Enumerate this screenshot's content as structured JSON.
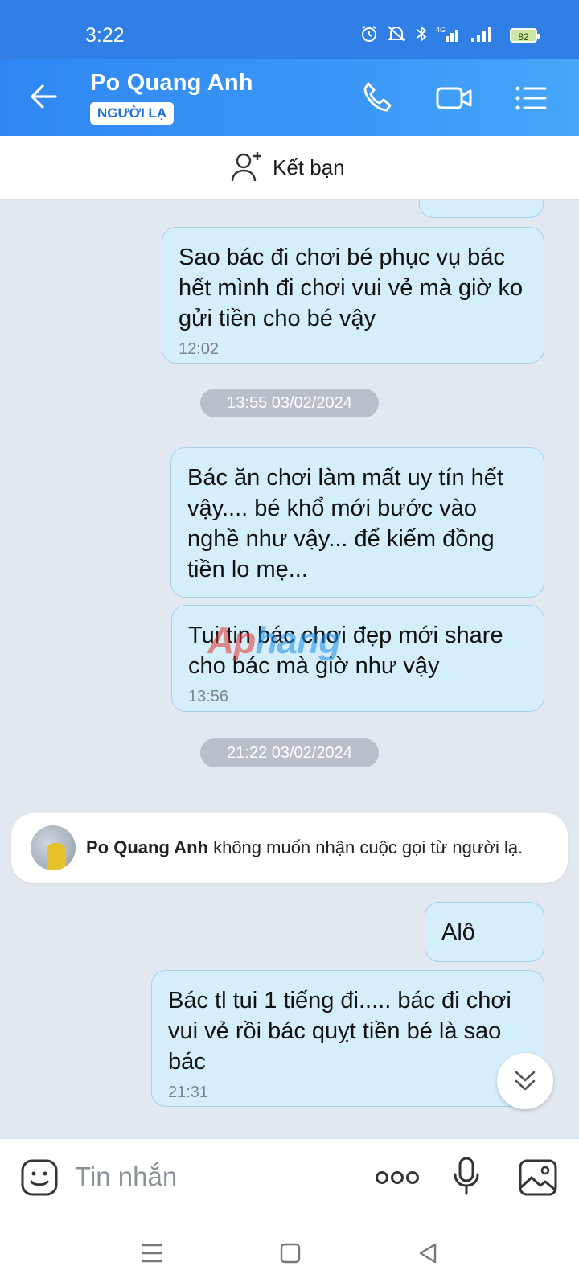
{
  "status": {
    "time": "3:22",
    "network": "4G",
    "battery": "82"
  },
  "header": {
    "name": "Po Quang Anh",
    "badge": "NGƯỜI LẠ"
  },
  "add_friend": {
    "label": "Kết bạn"
  },
  "messages": [
    {
      "text": "Sao bác đi chơi bé phục vụ bác hết mình đi chơi vui vẻ mà giờ ko gửi tiền cho bé vậy",
      "time": "12:02"
    },
    {
      "text": "Bác ăn chơi làm mất uy tín hết vậy.... bé khổ mới bước vào nghề như vậy... để kiếm đồng tiền lo mẹ...",
      "time": ""
    },
    {
      "text": "Tui tin bác chơi đẹp mới share cho bác mà giờ như vậy",
      "time": "13:56"
    },
    {
      "text": "Alô",
      "time": ""
    },
    {
      "text": "Bác tl tui 1 tiếng đi..... bác đi chơi vui vẻ rồi bác quỵt tiền bé là sao bác",
      "time": "21:31"
    }
  ],
  "date_separators": [
    "13:55 03/02/2024",
    "21:22 03/02/2024"
  ],
  "system_notice": {
    "name": "Po Quang Anh",
    "text": "không muốn nhận cuộc gọi từ người lạ."
  },
  "watermark": {
    "part1": "Ap",
    "part2": "hang"
  },
  "input": {
    "placeholder": "Tin nhắn"
  }
}
